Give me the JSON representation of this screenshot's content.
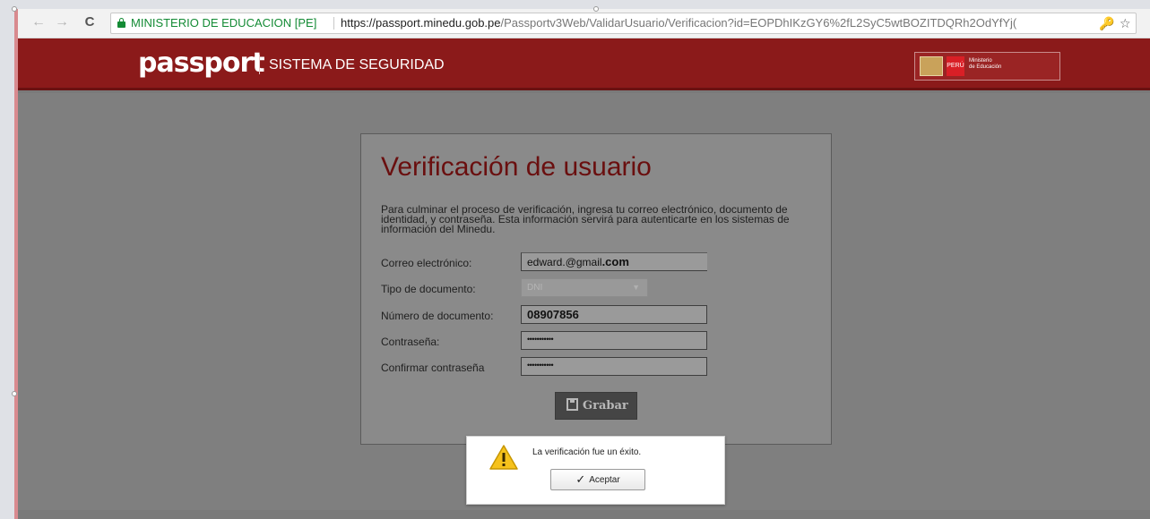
{
  "browser": {
    "site_name": "MINISTERIO DE EDUCACION [PE]",
    "url_host": "https://passport.minedu.gob.pe",
    "url_path": "/Passportv3Web/ValidarUsuario/Verificacion?id=EOPDhIKzGY6%2fL2SyC5wtBOZITDQRh2OdYfYj(",
    "icons": [
      "back-icon",
      "forward-icon",
      "reload-icon",
      "lock-icon",
      "key-icon",
      "star-icon"
    ]
  },
  "header": {
    "logo": "passport",
    "subtitle": "SISTEMA DE SEGURIDAD",
    "gov_flag_text": "PERÚ",
    "gov_ministry_line1": "Ministerio",
    "gov_ministry_line2": "de Educación"
  },
  "form": {
    "title": "Verificación de usuario",
    "description": "Para culminar el proceso de verificación, ingresa tu correo electrónico, documento de identidad, y contraseña. Esta información servirá para autenticarte en los sistemas de información del Minedu.",
    "email_label": "Correo electrónico:",
    "email_value_user": "edward.@gmail",
    "email_value_domain": ".com",
    "doctype_label": "Tipo de documento:",
    "doctype_value": "DNI",
    "docnum_label": "Número de documento:",
    "docnum_value": "08907856",
    "password_label": "Contraseña:",
    "password_value": "•••••••••••",
    "confirm_label": "Confirmar contraseña",
    "confirm_value": "•••••••••••",
    "save_button": "Grabar"
  },
  "dialog": {
    "message": "La verificación fue un éxito.",
    "accept_button": "Aceptar"
  },
  "colors": {
    "header_red": "#8b1a1a",
    "title_red": "#6a0f0f",
    "secure_green": "#148b35"
  }
}
